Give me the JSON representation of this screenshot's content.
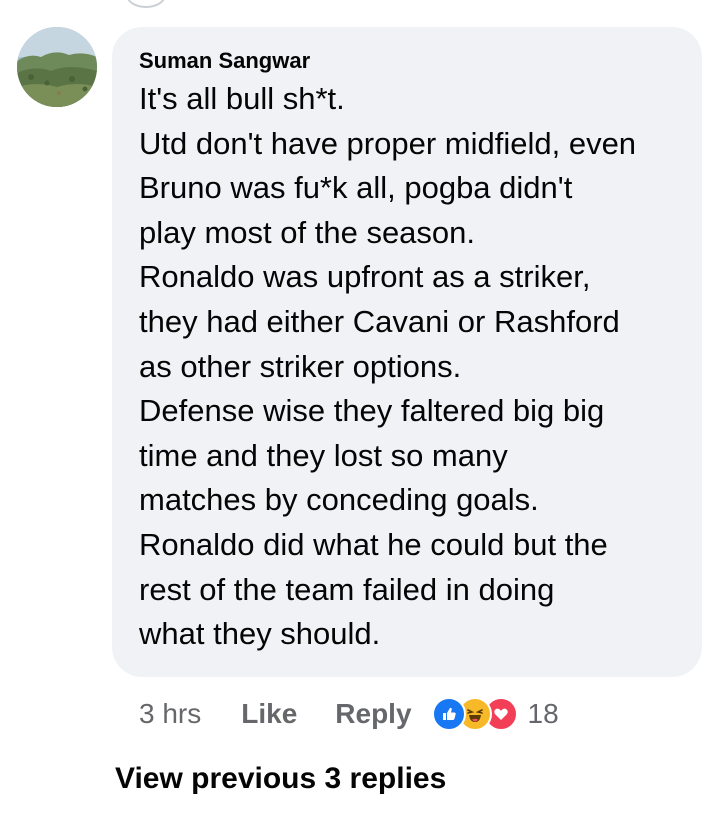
{
  "comment": {
    "author": "Suman Sangwar",
    "lines": [
      "It's all bull sh*t.",
      "Utd don't have proper midfield, even",
      "Bruno was fu*k all, pogba didn't",
      "play most of the season.",
      "Ronaldo was upfront as a striker,",
      "they had either Cavani or Rashford",
      "as other striker options.",
      "Defense wise they faltered big big",
      "time and they lost so many",
      "matches by conceding goals.",
      "Ronaldo did what he could but the",
      "rest of the team failed in doing",
      "what they should."
    ],
    "timestamp": "3 hrs",
    "like_label": "Like",
    "reply_label": "Reply",
    "reactions": [
      "like-icon",
      "haha-icon",
      "love-icon"
    ],
    "reaction_count": "18"
  },
  "thread": {
    "view_previous_label": "View previous 3 replies"
  },
  "colors": {
    "bubble": "#f0f2f5",
    "text": "#050505",
    "secondary_text": "#65676b",
    "like_blue": "#1877f2",
    "haha_yellow": "#f7b928",
    "love_red": "#f33e58"
  }
}
